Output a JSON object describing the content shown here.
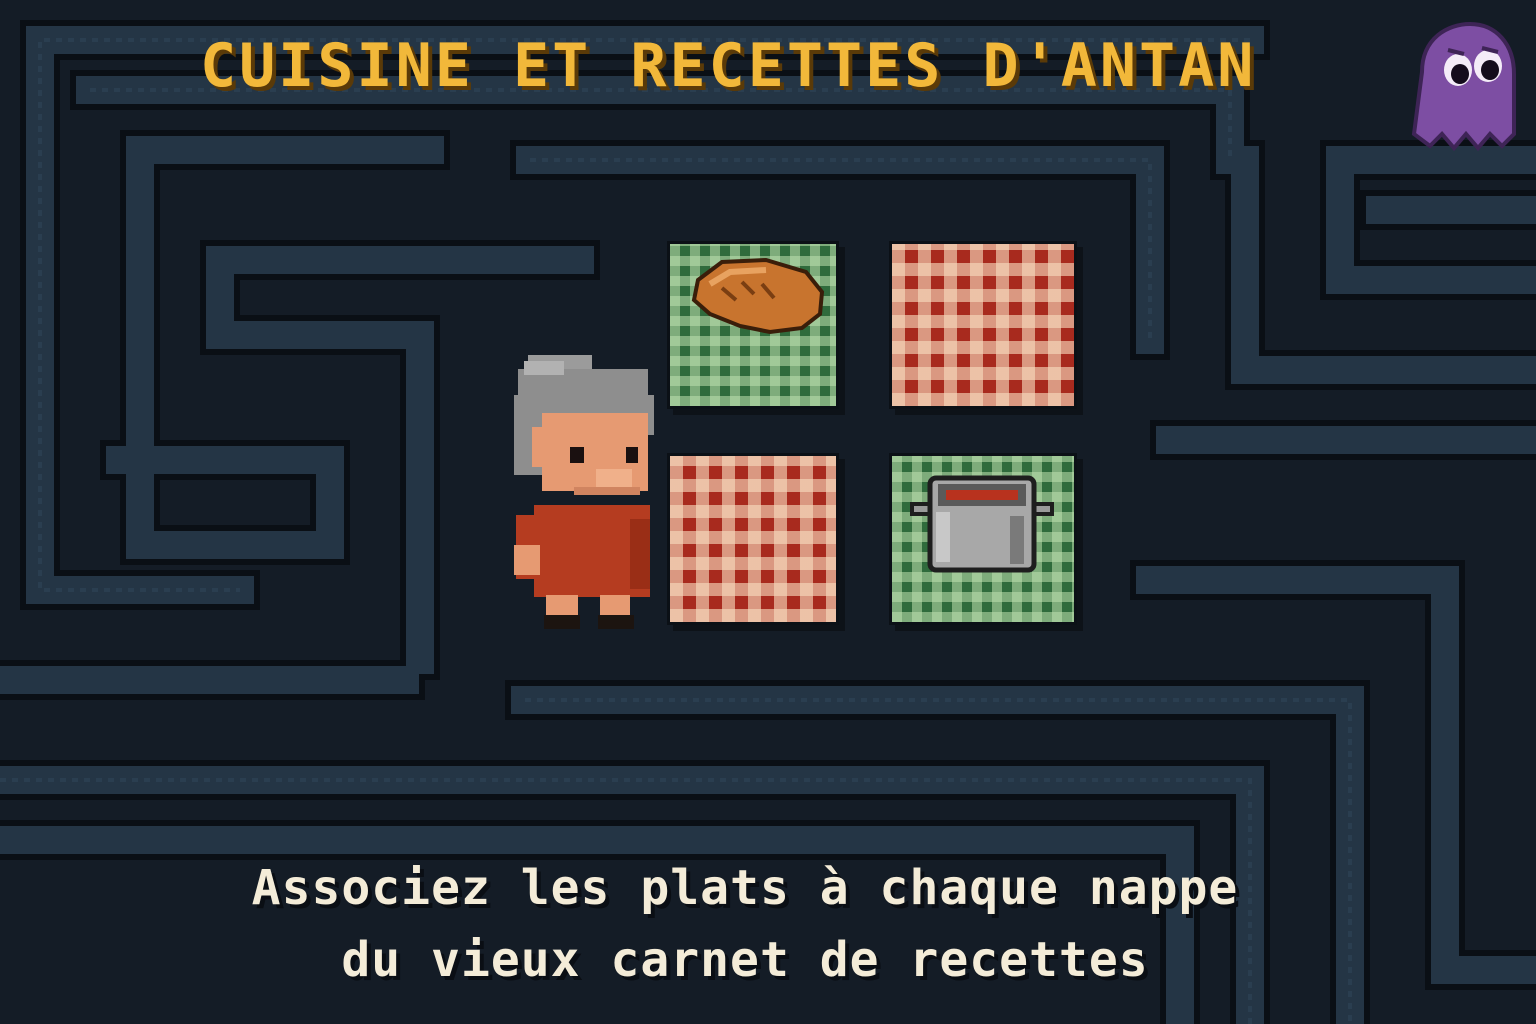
{
  "title": "CUISINE ET RECETTES D'ANTAN",
  "instructions": {
    "line1": "Associez les plats à chaque nappe",
    "line2": "du vieux carnet de recettes"
  },
  "tablecloths": [
    {
      "pattern": "green-gingham",
      "dish": "bread-icon"
    },
    {
      "pattern": "red-gingham",
      "dish": ""
    },
    {
      "pattern": "red-gingham",
      "dish": ""
    },
    {
      "pattern": "green-gingham",
      "dish": "cooking-pot-icon"
    }
  ],
  "characters": {
    "player": "grandmother",
    "enemy": "purple-ghost"
  },
  "colors": {
    "background": "#141c26",
    "maze_wall": "#243545",
    "title": "#f2b83a",
    "instructions": "#f4ecd8",
    "green_cloth": "#2f6b3c",
    "red_cloth": "#a82a1e",
    "ghost": "#7d4ea3"
  }
}
